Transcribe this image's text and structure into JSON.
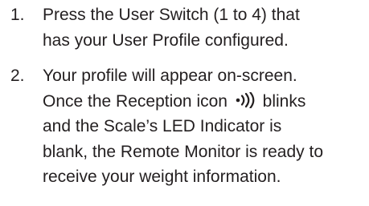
{
  "steps": [
    {
      "number": "1.",
      "lines": [
        "Press the User Switch (1 to 4) that",
        "has your User Profile configured."
      ]
    },
    {
      "number": "2.",
      "lines": [
        "Your profile will appear on-screen.",
        "",
        "and the Scale’s LED Indicator is",
        "blank, the Remote Monitor is ready to",
        "receive your weight information."
      ],
      "line2_before_icon": "Once the Reception icon",
      "line2_after_icon": "blinks",
      "icon": "reception-icon"
    }
  ],
  "colors": {
    "text": "#231f20"
  }
}
